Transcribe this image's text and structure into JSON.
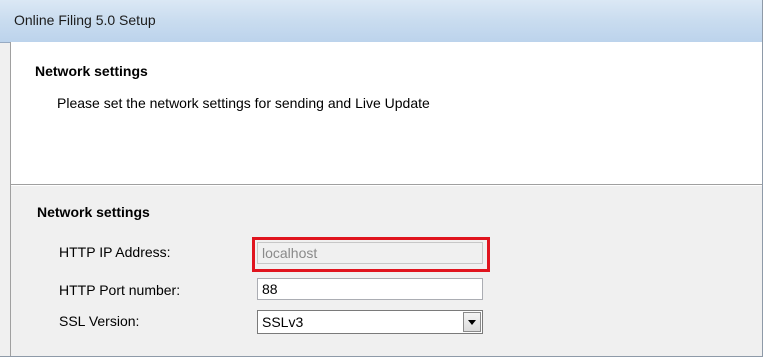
{
  "window": {
    "title": "Online Filing 5.0 Setup"
  },
  "header": {
    "title": "Network settings",
    "description": "Please set the network settings for sending and Live Update"
  },
  "group": {
    "title": "Network settings"
  },
  "fields": {
    "ip_label": "HTTP IP Address:",
    "ip_value": "localhost",
    "port_label": "HTTP Port number:",
    "port_value": "88",
    "ssl_label": "SSL Version:",
    "ssl_value": "SSLv3"
  },
  "colors": {
    "highlight": "#e0141e",
    "titlebar": "#c9dcef"
  }
}
